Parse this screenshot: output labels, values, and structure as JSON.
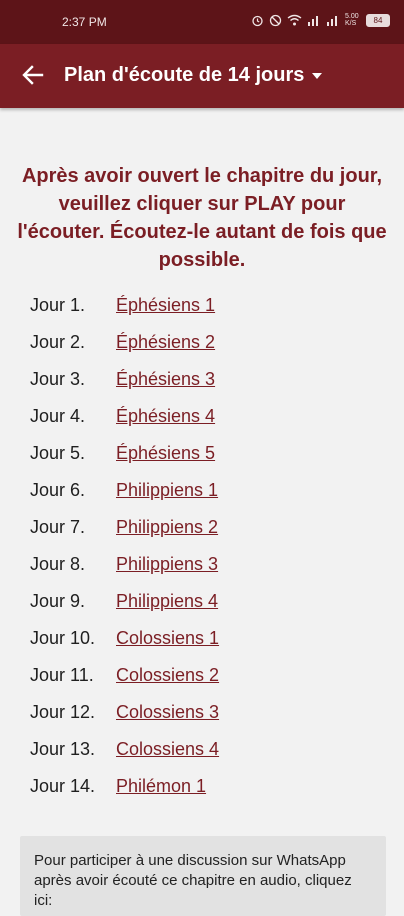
{
  "status_bar": {
    "time": "2:37 PM",
    "battery": "84",
    "network_speed": "5.00 K/S"
  },
  "header": {
    "title": "Plan d'écoute de 14 jours",
    "back_icon": "arrow-left-icon",
    "dropdown_icon": "caret-down-icon"
  },
  "instruction": "Après avoir ouvert le chapitre du jour, veuillez cliquer sur PLAY pour l'écouter. Écoutez-le autant de fois que possible.",
  "days": [
    {
      "day": "Jour 1.",
      "chapter": "Éphésiens 1"
    },
    {
      "day": "Jour 2.",
      "chapter": "Éphésiens 2"
    },
    {
      "day": "Jour 3.",
      "chapter": "Éphésiens 3"
    },
    {
      "day": "Jour 4.",
      "chapter": "Éphésiens 4"
    },
    {
      "day": "Jour 5.",
      "chapter": "Éphésiens 5"
    },
    {
      "day": "Jour 6.",
      "chapter": "Philippiens 1"
    },
    {
      "day": "Jour 7.",
      "chapter": "Philippiens 2"
    },
    {
      "day": "Jour 8.",
      "chapter": "Philippiens 3"
    },
    {
      "day": "Jour 9.",
      "chapter": "Philippiens 4"
    },
    {
      "day": "Jour 10.",
      "chapter": "Colossiens 1"
    },
    {
      "day": "Jour 11.",
      "chapter": "Colossiens 2"
    },
    {
      "day": "Jour 12.",
      "chapter": "Colossiens 3"
    },
    {
      "day": "Jour 13.",
      "chapter": "Colossiens 4"
    },
    {
      "day": "Jour 14.",
      "chapter": "Philémon 1"
    }
  ],
  "whatsapp_note": "Pour participer à une discussion sur WhatsApp après avoir écouté ce chapitre en audio, cliquez ici:",
  "colors": {
    "status_bar": "#5d1418",
    "app_bar": "#7b1e24",
    "accent": "#7b1e24",
    "background": "#f2f2f2",
    "note_box": "#e2e2e2"
  }
}
